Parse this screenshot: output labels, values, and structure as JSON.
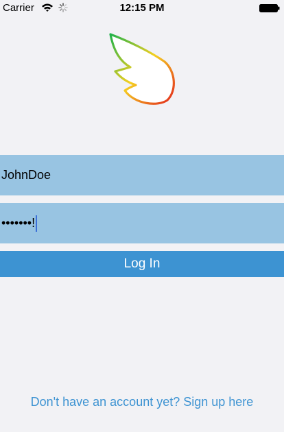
{
  "status_bar": {
    "carrier": "Carrier",
    "time": "12:15 PM",
    "wifi_icon": "wifi-icon",
    "activity_icon": "activity-spinner-icon",
    "battery_icon": "battery-icon"
  },
  "logo": {
    "icon": "wing-logo-icon",
    "colors": [
      "#1fb24a",
      "#f5d020",
      "#e3261c"
    ]
  },
  "login_form": {
    "username_value": "JohnDoe",
    "password_masked": "•••••••",
    "password_last_char": "!"
  },
  "login_button": {
    "label": "Log In",
    "color": "#3d93d2"
  },
  "signup": {
    "label": "Don't have an account yet? Sign up here"
  },
  "colors": {
    "background": "#f2f2f5",
    "field": "#98c4e2",
    "accent": "#3d93d2"
  }
}
